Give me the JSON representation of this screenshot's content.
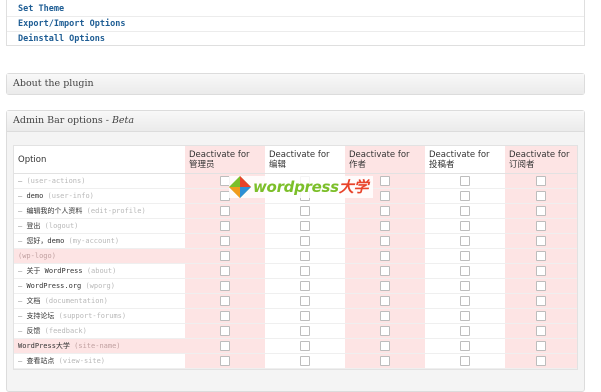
{
  "menu": {
    "items": [
      "Set Theme",
      "Export/Import Options",
      "Deinstall Options"
    ]
  },
  "about": {
    "title": "About the plugin"
  },
  "adminbar": {
    "title_main": "Admin Bar options - ",
    "title_beta": "Beta",
    "columns": [
      "Option",
      "Deactivate for\n管理员",
      "Deactivate for\n编辑",
      "Deactivate for\n作者",
      "Deactivate for\n投稿者",
      "Deactivate for\n订阅者"
    ],
    "rows": [
      {
        "label": "",
        "slug": "(user-actions)",
        "dash": true
      },
      {
        "label": "demo",
        "slug": "(user-info)",
        "dash": true
      },
      {
        "label": "编辑我的个人资料",
        "slug": "(edit-profile)",
        "dash": true
      },
      {
        "label": "登出",
        "slug": "(logout)",
        "dash": true
      },
      {
        "label": "您好，demo",
        "slug": "(my-account)",
        "dash": true
      },
      {
        "label": "",
        "slug": "(wp-logo)",
        "dash": false
      },
      {
        "label": "关于 WordPress",
        "slug": "(about)",
        "dash": true
      },
      {
        "label": "WordPress.org",
        "slug": "(wporg)",
        "dash": true
      },
      {
        "label": "文档",
        "slug": "(documentation)",
        "dash": true
      },
      {
        "label": "支持论坛",
        "slug": "(support-forums)",
        "dash": true
      },
      {
        "label": "反馈",
        "slug": "(feedback)",
        "dash": true
      },
      {
        "label": "WordPress大学",
        "slug": "(site-name)",
        "dash": false
      },
      {
        "label": "查看站点",
        "slug": "(view-site)",
        "dash": true
      }
    ]
  },
  "watermark": {
    "text_main": "wordpress",
    "text_suffix": "大学",
    "colors": {
      "main": "#7cbf2a",
      "suffix": "#e8432a"
    }
  },
  "colors": {
    "link": "#1e5d94",
    "highlight": "#fde4e4"
  }
}
